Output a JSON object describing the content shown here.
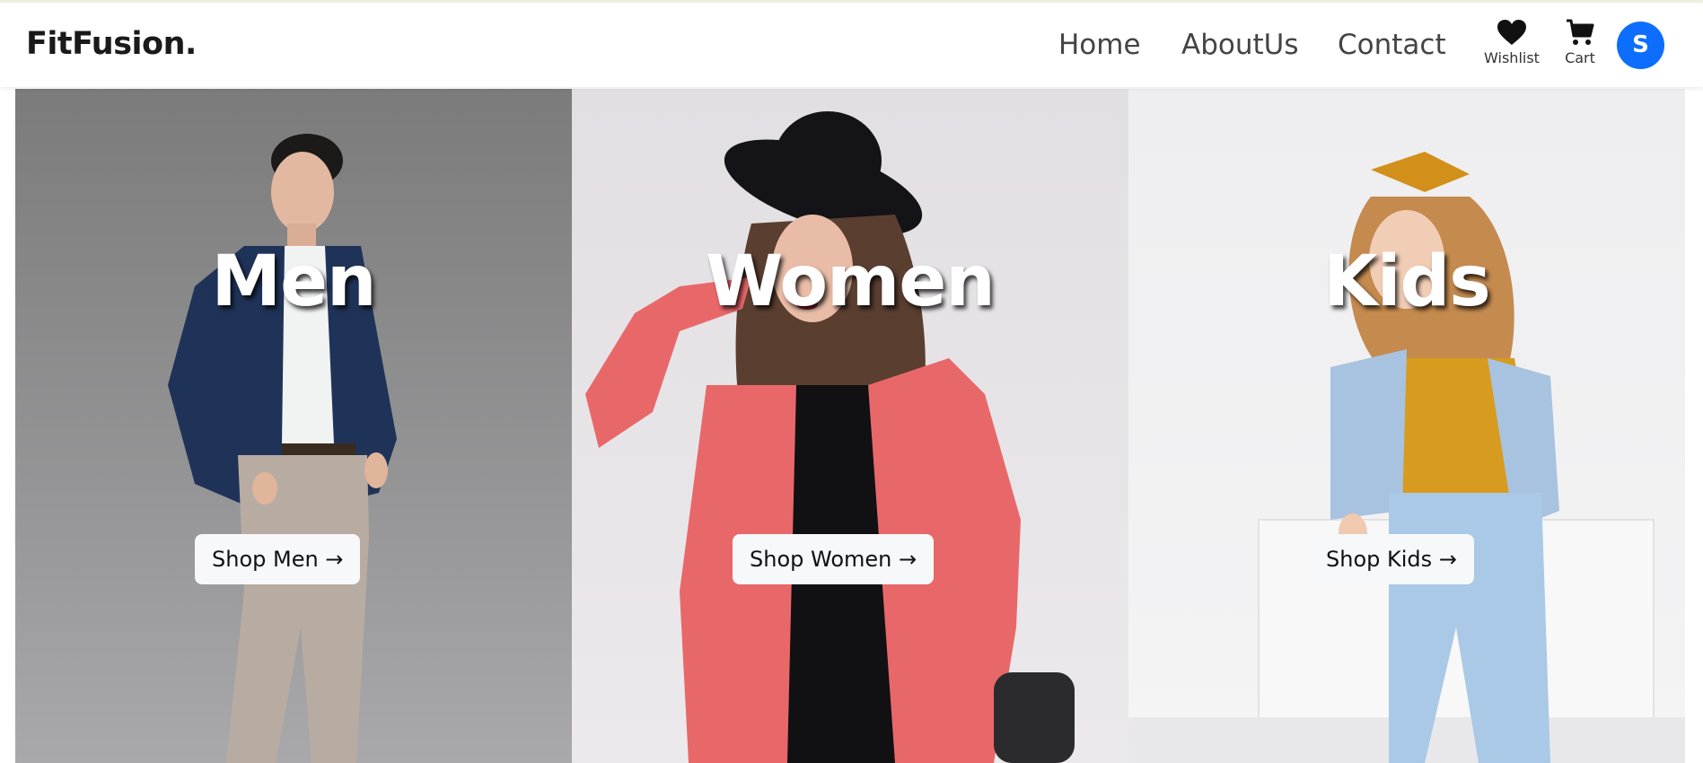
{
  "brand": "FitFusion.",
  "nav": {
    "home": "Home",
    "about": "AboutUs",
    "contact": "Contact"
  },
  "icons": {
    "wishlist": {
      "icon": "heart-icon",
      "label": "Wishlist"
    },
    "cart": {
      "icon": "cart-icon",
      "label": "Cart"
    }
  },
  "avatar": {
    "initial": "S",
    "color": "#0d6efd"
  },
  "panels": [
    {
      "title": "Men",
      "button": "Shop Men →"
    },
    {
      "title": "Women",
      "button": "Shop Women →"
    },
    {
      "title": "Kids",
      "button": "Shop Kids →"
    }
  ]
}
